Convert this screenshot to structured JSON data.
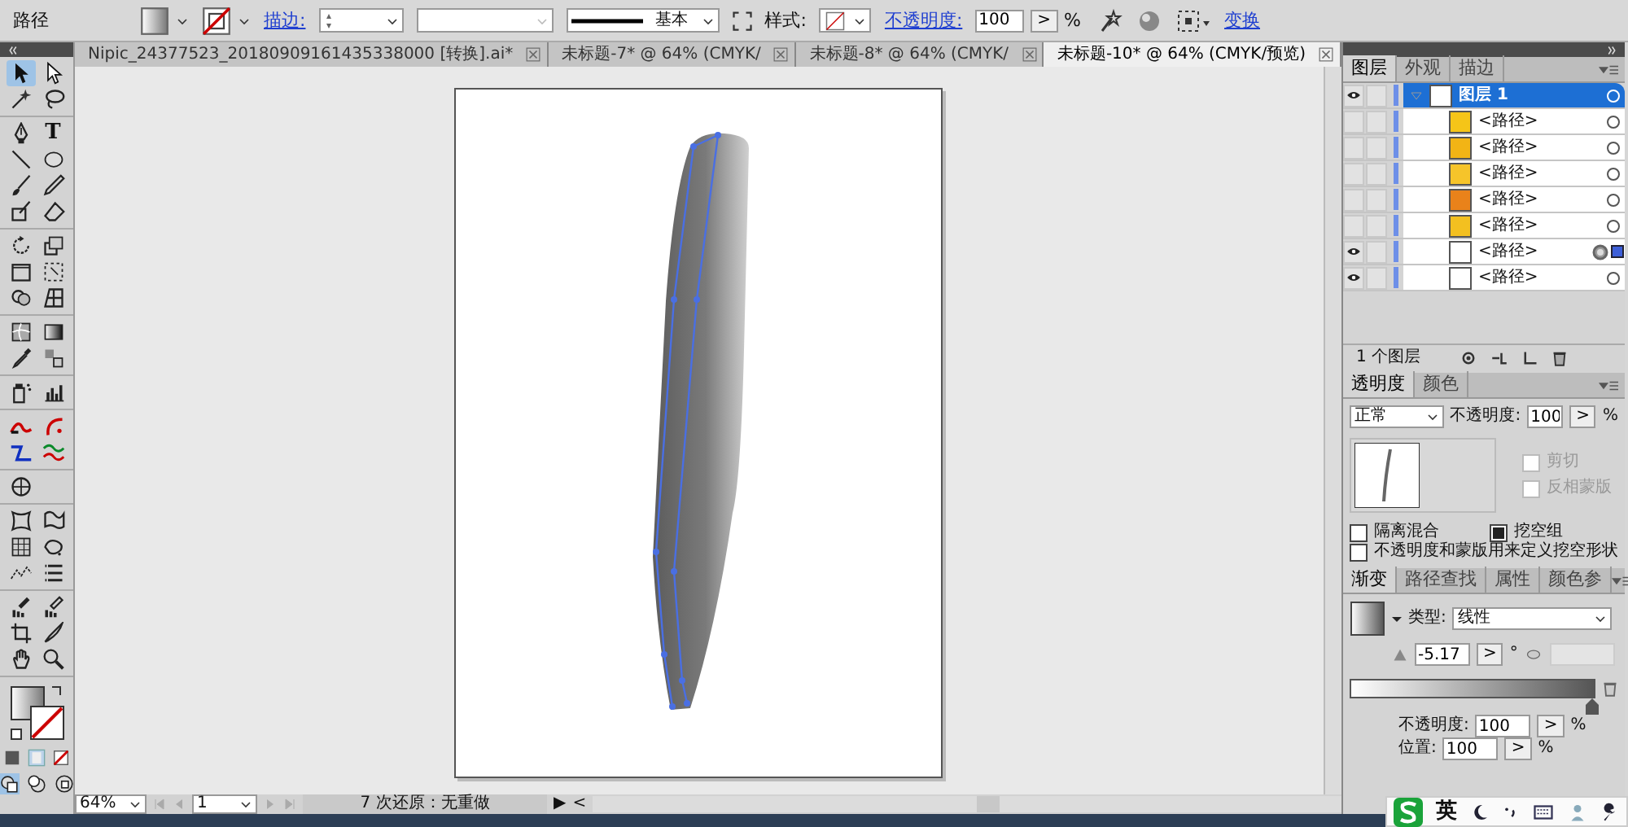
{
  "control_bar": {
    "label": "路径",
    "stroke_link": "描边:",
    "brush_style": "基本",
    "style_label": "样式:",
    "opacity_link": "不透明度:",
    "opacity_value": "100",
    "opacity_arrow": ">",
    "percent": "%",
    "transform_link": "变换"
  },
  "tools": [
    {
      "selected": true
    },
    {
      "selected": false
    },
    {
      "selected": false
    },
    {
      "selected": false
    },
    {
      "selected": false
    },
    {
      "selected": false,
      "glyph": "T"
    },
    {
      "selected": false
    },
    {
      "selected": false
    },
    {
      "selected": false
    },
    {
      "selected": false
    },
    {
      "selected": false
    },
    {
      "selected": false
    },
    {
      "selected": false
    },
    {
      "selected": false
    },
    {
      "selected": false
    },
    {
      "selected": false
    },
    {
      "selected": false
    },
    {
      "selected": false
    },
    {
      "selected": false
    },
    {
      "selected": false
    },
    {
      "selected": false
    },
    {
      "selected": false
    },
    {
      "selected": false
    },
    {
      "selected": false
    },
    {
      "selected": false
    },
    {
      "selected": false
    },
    {
      "selected": false
    },
    {
      "selected": false
    },
    {
      "selected": false
    },
    {
      "selected": false
    },
    {
      "selected": false
    },
    {
      "selected": false
    },
    {
      "selected": false
    },
    {
      "selected": false
    },
    {
      "selected": false
    },
    {
      "selected": false
    },
    {
      "selected": false
    },
    {
      "selected": false
    },
    {
      "selected": false
    },
    {
      "selected": false
    },
    {
      "selected": false
    }
  ],
  "document_tabs": [
    {
      "label": "Nipic_24377523_20180909161435338000 [转换].ai*",
      "selected": false
    },
    {
      "label": "未标题-7* @ 64% (CMYK/",
      "selected": false
    },
    {
      "label": "未标题-8* @ 64% (CMYK/",
      "selected": false
    },
    {
      "label": "未标题-10* @ 64% (CMYK/预览)",
      "selected": true
    }
  ],
  "status_bar": {
    "zoom": "64%",
    "page": "1",
    "history": "7 次还原：无重做",
    "play": "▶",
    "scroll_left": "<"
  },
  "layers_panel": {
    "tabs": [
      {
        "label": "图层",
        "selected": true
      },
      {
        "label": "外观",
        "selected": false
      },
      {
        "label": "描边",
        "selected": false
      }
    ],
    "layer": {
      "name": "图层 1",
      "visible": true,
      "selected": true,
      "expanded": true
    },
    "items": [
      {
        "name": "<路径>",
        "visible": false,
        "targeted": false,
        "color": "#f5c518"
      },
      {
        "name": "<路径>",
        "visible": false,
        "targeted": false,
        "color": "#f2b415"
      },
      {
        "name": "<路径>",
        "visible": false,
        "targeted": false,
        "color": "#f6c42a"
      },
      {
        "name": "<路径>",
        "visible": false,
        "targeted": false,
        "color": "#e9821a"
      },
      {
        "name": "<路径>",
        "visible": false,
        "targeted": false,
        "color": "#f3c020"
      },
      {
        "name": "<路径>",
        "visible": true,
        "targeted": true,
        "color": "#ffffff"
      },
      {
        "name": "<路径>",
        "visible": true,
        "targeted": false,
        "color": "#ffffff"
      }
    ],
    "count": "1 个图层"
  },
  "transparency_panel": {
    "tabs": [
      {
        "label": "透明度",
        "selected": true
      },
      {
        "label": "颜色",
        "selected": false
      }
    ],
    "blend_mode": "正常",
    "opacity_label": "不透明度:",
    "opacity_value": "100",
    "opacity_arrow": ">",
    "percent": "%",
    "mask_options": [
      {
        "label": "剪切",
        "checked": false,
        "disabled": true
      },
      {
        "label": "反相蒙版",
        "checked": false,
        "disabled": true
      }
    ],
    "options": [
      {
        "label": "隔离混合",
        "checked": false
      },
      {
        "label": "挖空组",
        "checked": true
      },
      {
        "label": "不透明度和蒙版用来定义挖空形状",
        "checked": false
      }
    ]
  },
  "gradient_panel": {
    "tabs": [
      {
        "label": "渐变",
        "selected": true
      },
      {
        "label": "路径查找",
        "selected": false
      },
      {
        "label": "属性",
        "selected": false
      },
      {
        "label": "颜色参",
        "selected": false
      }
    ],
    "type_label": "类型:",
    "type_value": "线性",
    "angle": "-5.17",
    "angle_arrow": ">",
    "degree": "°",
    "opacity_label": "不透明度:",
    "opacity_value": "100",
    "opacity_arrow": ">",
    "opacity_percent": "%",
    "location_label": "位置:",
    "location_value": "100",
    "location_arrow": ">",
    "location_percent": "%"
  },
  "ime_bar": {
    "mode": "英"
  }
}
